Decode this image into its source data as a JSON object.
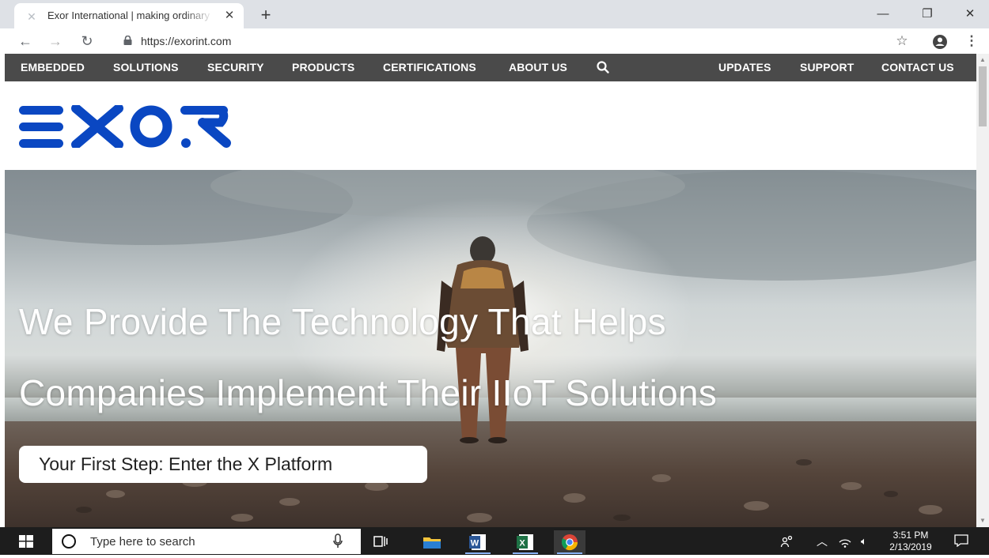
{
  "browser": {
    "tab": {
      "title": "Exor International | making ordinary",
      "close_glyph": "✕",
      "favicon": "exor-x-icon"
    },
    "new_tab_glyph": "+",
    "window_controls": {
      "minimize": "—",
      "restore": "❐",
      "close": "✕"
    },
    "nav": {
      "back": "←",
      "forward": "→",
      "reload": "↻"
    },
    "url": "https://exorint.com",
    "bookmark_glyph": "☆",
    "menu_glyph": "⋮"
  },
  "site_nav": {
    "left": [
      {
        "id": "embedded",
        "label": "EMBEDDED"
      },
      {
        "id": "solutions",
        "label": "SOLUTIONS"
      },
      {
        "id": "security",
        "label": "SECURITY"
      },
      {
        "id": "products",
        "label": "PRODUCTS"
      },
      {
        "id": "certifications",
        "label": "CERTIFICATIONS"
      },
      {
        "id": "about",
        "label": "ABOUT US"
      }
    ],
    "right": [
      {
        "id": "updates",
        "label": "UPDATES"
      },
      {
        "id": "support",
        "label": "SUPPORT"
      },
      {
        "id": "contact",
        "label": "CONTACT US"
      }
    ]
  },
  "logo": {
    "text": "EXOR",
    "color": "#0a47c2"
  },
  "hero": {
    "headline_line1": "We Provide The Technology That Helps",
    "headline_line2": "Companies Implement Their IIoT Solutions",
    "cta_label": "Your First Step: Enter the X Platform"
  },
  "taskbar": {
    "search_placeholder": "Type here to search",
    "apps": [
      "task-view",
      "file-explorer",
      "word",
      "excel",
      "chrome"
    ],
    "time": "3:51 PM",
    "date": "2/13/2019"
  },
  "colors": {
    "nav_bg": "#4a4a4a",
    "taskbar_bg": "#1d1d1d",
    "brand_blue": "#0a47c2"
  }
}
